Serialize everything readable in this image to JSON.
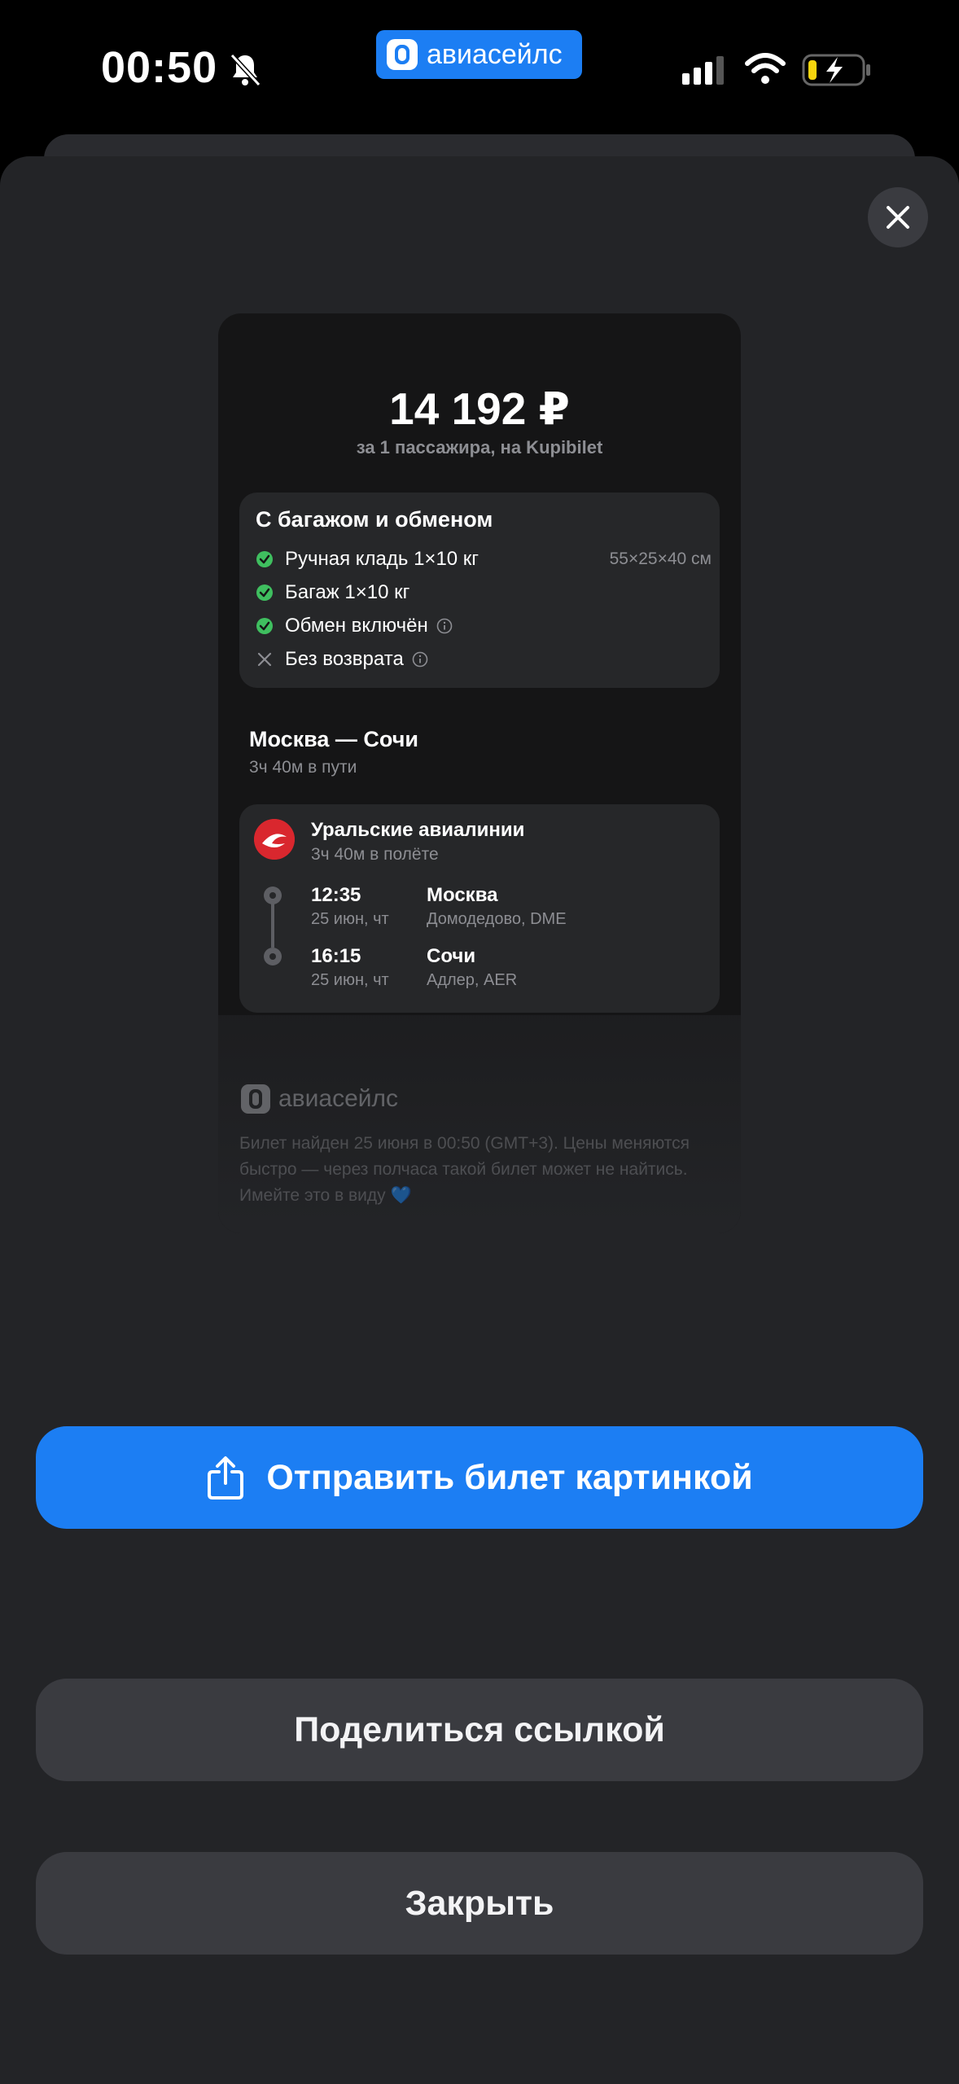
{
  "status_bar": {
    "time": "00:50",
    "app_name": "авиасейлс"
  },
  "ticket": {
    "price": "14 192 ₽",
    "price_note": "за 1 пассажира, на Kupibilet",
    "tariff": {
      "title": "С багажом и обменом",
      "features": [
        {
          "label": "Ручная кладь 1×10 кг",
          "detail": "55×25×40 см",
          "status": "included"
        },
        {
          "label": "Багаж 1×10 кг",
          "status": "included"
        },
        {
          "label": "Обмен включён",
          "status": "included"
        },
        {
          "label": "Без возврата",
          "status": "excluded"
        }
      ]
    },
    "route": {
      "title": "Москва — Сочи",
      "duration": "3ч 40м в пути"
    },
    "flight": {
      "airline": "Уральские авиалинии",
      "flight_duration": "3ч 40м в полёте",
      "departure": {
        "time": "12:35",
        "date": "25 июн, чт",
        "city": "Москва",
        "airport": "Домодедово, DME"
      },
      "arrival": {
        "time": "16:15",
        "date": "25 июн, чт",
        "city": "Сочи",
        "airport": "Адлер, AER"
      }
    },
    "footer": {
      "brand": "авиасейлс",
      "notice": "Билет найден 25 июня в 00:50 (GMT+3). Цены меняются быстро — через полчаса такой билет может не найтись. Имейте это в виду 💙"
    }
  },
  "actions": {
    "send_image": "Отправить билет картинкой",
    "share_link": "Поделиться ссылкой",
    "close": "Закрыть"
  },
  "colors": {
    "accent": "#1c7ef3",
    "included": "#3fbf5f",
    "airline": "#d9272e"
  }
}
